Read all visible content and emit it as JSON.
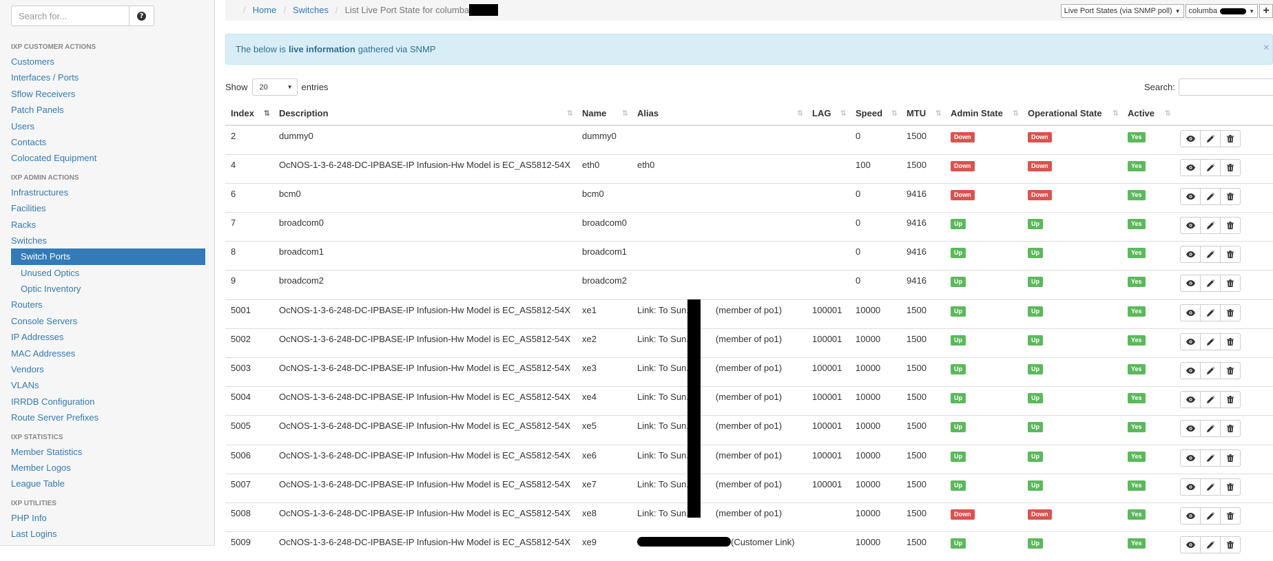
{
  "sidebar": {
    "search_placeholder": "Search for...",
    "sections": [
      {
        "title": "IXP CUSTOMER ACTIONS",
        "items": [
          {
            "label": "Customers",
            "active": false,
            "sub": false
          },
          {
            "label": "Interfaces / Ports",
            "active": false,
            "sub": false
          },
          {
            "label": "Sflow Receivers",
            "active": false,
            "sub": false
          },
          {
            "label": "Patch Panels",
            "active": false,
            "sub": false
          },
          {
            "label": "Users",
            "active": false,
            "sub": false
          },
          {
            "label": "Contacts",
            "active": false,
            "sub": false
          },
          {
            "label": "Colocated Equipment",
            "active": false,
            "sub": false
          }
        ]
      },
      {
        "title": "IXP ADMIN ACTIONS",
        "items": [
          {
            "label": "Infrastructures",
            "active": false,
            "sub": false
          },
          {
            "label": "Facilities",
            "active": false,
            "sub": false
          },
          {
            "label": "Racks",
            "active": false,
            "sub": false
          },
          {
            "label": "Switches",
            "active": false,
            "sub": false
          },
          {
            "label": "Switch Ports",
            "active": true,
            "sub": true
          },
          {
            "label": "Unused Optics",
            "active": false,
            "sub": true
          },
          {
            "label": "Optic Inventory",
            "active": false,
            "sub": true
          },
          {
            "label": "Routers",
            "active": false,
            "sub": false
          },
          {
            "label": "Console Servers",
            "active": false,
            "sub": false
          },
          {
            "label": "IP Addresses",
            "active": false,
            "sub": false
          },
          {
            "label": "MAC Addresses",
            "active": false,
            "sub": false
          },
          {
            "label": "Vendors",
            "active": false,
            "sub": false
          },
          {
            "label": "VLANs",
            "active": false,
            "sub": false
          },
          {
            "label": "IRRDB Configuration",
            "active": false,
            "sub": false
          },
          {
            "label": "Route Server Prefixes",
            "active": false,
            "sub": false
          }
        ]
      },
      {
        "title": "IXP STATISTICS",
        "items": [
          {
            "label": "Member Statistics",
            "active": false,
            "sub": false
          },
          {
            "label": "Member Logos",
            "active": false,
            "sub": false
          },
          {
            "label": "League Table",
            "active": false,
            "sub": false
          }
        ]
      },
      {
        "title": "IXP UTILITIES",
        "items": [
          {
            "label": "PHP Info",
            "active": false,
            "sub": false
          },
          {
            "label": "Last Logins",
            "active": false,
            "sub": false
          }
        ]
      }
    ]
  },
  "breadcrumb": {
    "home": "Home",
    "switches": "Switches",
    "current": "List Live Port State for columba"
  },
  "top_controls": {
    "mode_select": "Live Port States (via SNMP poll)",
    "switch_select": "columba",
    "plus": "+"
  },
  "alert": {
    "prefix": "The below is",
    "bold": "live information",
    "suffix": "gathered via SNMP",
    "close": "×"
  },
  "table_controls": {
    "show": "Show",
    "length": "20",
    "entries": "entries",
    "search": "Search:"
  },
  "table": {
    "columns": [
      "Index",
      "Description",
      "Name",
      "Alias",
      "LAG",
      "Speed",
      "MTU",
      "Admin State",
      "Operational State",
      "Active"
    ],
    "rows": [
      {
        "index": "2",
        "description": "dummy0",
        "name": "dummy0",
        "alias": "",
        "lag": "",
        "speed": "0",
        "mtu": "1500",
        "admin": "Down",
        "oper": "Down",
        "active": "Yes"
      },
      {
        "index": "4",
        "description": "OcNOS-1-3-6-248-DC-IPBASE-IP Infusion-Hw Model is EC_AS5812-54X",
        "name": "eth0",
        "alias": "eth0",
        "lag": "",
        "speed": "100",
        "mtu": "1500",
        "admin": "Down",
        "oper": "Down",
        "active": "Yes"
      },
      {
        "index": "6",
        "description": "bcm0",
        "name": "bcm0",
        "alias": "",
        "lag": "",
        "speed": "0",
        "mtu": "9416",
        "admin": "Down",
        "oper": "Down",
        "active": "Yes"
      },
      {
        "index": "7",
        "description": "broadcom0",
        "name": "broadcom0",
        "alias": "",
        "lag": "",
        "speed": "0",
        "mtu": "9416",
        "admin": "Up",
        "oper": "Up",
        "active": "Yes"
      },
      {
        "index": "8",
        "description": "broadcom1",
        "name": "broadcom1",
        "alias": "",
        "lag": "",
        "speed": "0",
        "mtu": "9416",
        "admin": "Up",
        "oper": "Up",
        "active": "Yes"
      },
      {
        "index": "9",
        "description": "broadcom2",
        "name": "broadcom2",
        "alias": "",
        "lag": "",
        "speed": "0",
        "mtu": "9416",
        "admin": "Up",
        "oper": "Up",
        "active": "Yes"
      },
      {
        "index": "5001",
        "description": "OcNOS-1-3-6-248-DC-IPBASE-IP Infusion-Hw Model is EC_AS5812-54X",
        "name": "xe1",
        "alias": "Link: To Sun.c         (member of po1)",
        "lag": "100001",
        "speed": "10000",
        "mtu": "1500",
        "admin": "Up",
        "oper": "Up",
        "active": "Yes"
      },
      {
        "index": "5002",
        "description": "OcNOS-1-3-6-248-DC-IPBASE-IP Infusion-Hw Model is EC_AS5812-54X",
        "name": "xe2",
        "alias": "Link: To Sun.c         (member of po1)",
        "lag": "100001",
        "speed": "10000",
        "mtu": "1500",
        "admin": "Up",
        "oper": "Up",
        "active": "Yes"
      },
      {
        "index": "5003",
        "description": "OcNOS-1-3-6-248-DC-IPBASE-IP Infusion-Hw Model is EC_AS5812-54X",
        "name": "xe3",
        "alias": "Link: To Sun.c         (member of po1)",
        "lag": "100001",
        "speed": "10000",
        "mtu": "1500",
        "admin": "Up",
        "oper": "Up",
        "active": "Yes"
      },
      {
        "index": "5004",
        "description": "OcNOS-1-3-6-248-DC-IPBASE-IP Infusion-Hw Model is EC_AS5812-54X",
        "name": "xe4",
        "alias": "Link: To Sun.c         (member of po1)",
        "lag": "100001",
        "speed": "10000",
        "mtu": "1500",
        "admin": "Up",
        "oper": "Up",
        "active": "Yes"
      },
      {
        "index": "5005",
        "description": "OcNOS-1-3-6-248-DC-IPBASE-IP Infusion-Hw Model is EC_AS5812-54X",
        "name": "xe5",
        "alias": "Link: To Sun.c         (member of po1)",
        "lag": "100001",
        "speed": "10000",
        "mtu": "1500",
        "admin": "Up",
        "oper": "Up",
        "active": "Yes"
      },
      {
        "index": "5006",
        "description": "OcNOS-1-3-6-248-DC-IPBASE-IP Infusion-Hw Model is EC_AS5812-54X",
        "name": "xe6",
        "alias": "Link: To Sun.c         (member of po1)",
        "lag": "100001",
        "speed": "10000",
        "mtu": "1500",
        "admin": "Up",
        "oper": "Up",
        "active": "Yes"
      },
      {
        "index": "5007",
        "description": "OcNOS-1-3-6-248-DC-IPBASE-IP Infusion-Hw Model is EC_AS5812-54X",
        "name": "xe7",
        "alias": "Link: To Sun.c         (member of po1)",
        "lag": "100001",
        "speed": "10000",
        "mtu": "1500",
        "admin": "Up",
        "oper": "Up",
        "active": "Yes"
      },
      {
        "index": "5008",
        "description": "OcNOS-1-3-6-248-DC-IPBASE-IP Infusion-Hw Model is EC_AS5812-54X",
        "name": "xe8",
        "alias": "Link: To Sun.c         (member of po1)",
        "lag": "",
        "speed": "10000",
        "mtu": "1500",
        "admin": "Down",
        "oper": "Down",
        "active": "Yes"
      },
      {
        "index": "5009",
        "description": "OcNOS-1-3-6-248-DC-IPBASE-IP Infusion-Hw Model is EC_AS5812-54X",
        "name": "xe9",
        "alias": "(Customer Link)",
        "lag": "",
        "speed": "10000",
        "mtu": "1500",
        "admin": "Up",
        "oper": "Up",
        "active": "Yes"
      }
    ]
  },
  "icons": {
    "view": "eye-icon",
    "edit": "pencil-icon",
    "delete": "trash-icon",
    "help": "question-circle-icon"
  },
  "colors": {
    "primary": "#337ab7",
    "danger": "#d9534f",
    "success": "#5cb85c",
    "info_bg": "#d9edf7",
    "info_text": "#31708f"
  }
}
